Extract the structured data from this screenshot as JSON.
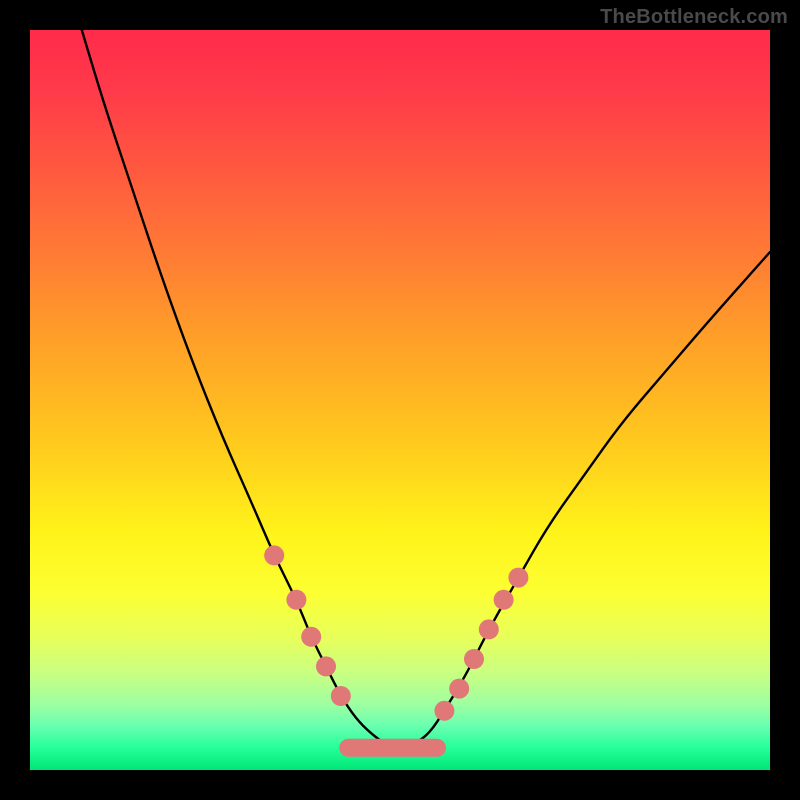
{
  "watermark": "TheBottleneck.com",
  "chart_data": {
    "type": "line",
    "title": "",
    "xlabel": "",
    "ylabel": "",
    "xlim": [
      0,
      100
    ],
    "ylim": [
      0,
      100
    ],
    "grid": false,
    "legend": false,
    "background_gradient": {
      "orientation": "vertical",
      "stops": [
        {
          "pos": 0.0,
          "color": "#ff2b4a"
        },
        {
          "pos": 0.3,
          "color": "#ff7a35"
        },
        {
          "pos": 0.55,
          "color": "#ffc71e"
        },
        {
          "pos": 0.76,
          "color": "#fcff32"
        },
        {
          "pos": 0.91,
          "color": "#9fffa0"
        },
        {
          "pos": 1.0,
          "color": "#00e676"
        }
      ]
    },
    "series": [
      {
        "name": "bottleneck-curve",
        "color": "#000000",
        "x": [
          7,
          10,
          14,
          18,
          22,
          26,
          30,
          33,
          36,
          38,
          40,
          42,
          44,
          46,
          48,
          50,
          52,
          54,
          56,
          59,
          62,
          66,
          70,
          75,
          80,
          86,
          92,
          100
        ],
        "y": [
          100,
          90,
          78,
          66,
          55,
          45,
          36,
          29,
          23,
          18,
          14,
          10,
          7,
          5,
          3.5,
          3,
          3.5,
          5,
          8,
          13,
          19,
          26,
          33,
          40,
          47,
          54,
          61,
          70
        ]
      }
    ],
    "markers": [
      {
        "name": "left-slope-points",
        "color": "#e07878",
        "radius": 10,
        "points": [
          {
            "x": 33,
            "y": 29
          },
          {
            "x": 36,
            "y": 23
          },
          {
            "x": 38,
            "y": 18
          },
          {
            "x": 40,
            "y": 14
          },
          {
            "x": 42,
            "y": 10
          }
        ]
      },
      {
        "name": "right-slope-points",
        "color": "#e07878",
        "radius": 10,
        "points": [
          {
            "x": 56,
            "y": 8
          },
          {
            "x": 58,
            "y": 11
          },
          {
            "x": 60,
            "y": 15
          },
          {
            "x": 62,
            "y": 19
          },
          {
            "x": 64,
            "y": 23
          },
          {
            "x": 66,
            "y": 26
          }
        ]
      },
      {
        "name": "valley-floor-band",
        "color": "#e07878",
        "shape": "rounded-band",
        "points": [
          {
            "x": 43,
            "y": 3
          },
          {
            "x": 55,
            "y": 3
          }
        ],
        "thickness": 18
      }
    ]
  }
}
